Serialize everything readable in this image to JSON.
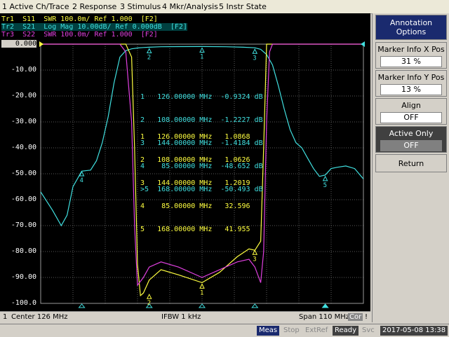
{
  "menu": [
    "1 Active Ch/Trace",
    "2 Response",
    "3 Stimulus",
    "4 Mkr/Analysis",
    "5 Instr State"
  ],
  "traces": [
    {
      "label": "Tr1  S11  SWR 100.0m/ Ref 1.000  [F2]",
      "color": "#ffff40"
    },
    {
      "label": "Tr2  S21  Log Mag 10.00dB/ Ref 0.000dB  [F2]",
      "color": "#40e0e0"
    },
    {
      "label": "Tr3  S22  SWR 100.0m/ Ref 1.000  [F2]",
      "color": "#e040e0"
    }
  ],
  "y_labels": [
    "0.000",
    "-10.00",
    "-20.00",
    "-30.00",
    "-40.00",
    "-50.00",
    "-60.00",
    "-70.00",
    "-80.00",
    "-90.00",
    "-100.0"
  ],
  "marker_table_s21": [
    "1   126.00000 MHz  -0.9324 dB",
    "2   108.00000 MHz  -1.2227 dB",
    "3   144.00000 MHz  -1.4184 dB",
    "4    85.00000 MHz  -48.652 dB",
    ">5  168.00000 MHz  -50.493 dB"
  ],
  "marker_table_swr": [
    "1   126.00000 MHz   1.0868",
    "2   108.00000 MHz   1.0626",
    "3   144.00000 MHz   1.2019",
    "4    85.00000 MHz   32.596",
    "5   168.00000 MHz   41.955"
  ],
  "sidepanel": {
    "title": "Annotation Options",
    "marker_x_label": "Marker Info X Pos",
    "marker_x_value": "31 %",
    "marker_y_label": "Marker Info Y Pos",
    "marker_y_value": "13 %",
    "align_label": "Align",
    "align_value": "OFF",
    "active_only_label": "Active Only",
    "active_only_value": "OFF",
    "return_label": "Return"
  },
  "status": {
    "channel": "1",
    "center": "Center 126 MHz",
    "ifbw": "IFBW 1 kHz",
    "span": "Span 110 MHz",
    "cor": "Cor",
    "excl": "!"
  },
  "bottom": {
    "meas": "Meas",
    "stop": "Stop",
    "extref": "ExtRef",
    "ready": "Ready",
    "svc": "Svc",
    "datetime": "2017-05-08 13:38"
  },
  "chart_data": {
    "type": "line",
    "x": [
      71,
      126,
      181
    ],
    "xlabel": "",
    "ylabel": "",
    "ylim": [
      -100,
      0
    ],
    "series": [
      {
        "name": "S21",
        "x_mhz": [
          71,
          75,
          78,
          80,
          82,
          85,
          88,
          90,
          92,
          94,
          96,
          98,
          100,
          102,
          104,
          106,
          108,
          112,
          118,
          126,
          134,
          140,
          144,
          146,
          148,
          150,
          152,
          154,
          156,
          158,
          160,
          162,
          164,
          166,
          168,
          170,
          172,
          175,
          178,
          181
        ],
        "values": [
          -57,
          -64,
          -70,
          -66,
          -55,
          -49,
          -48.6,
          -45,
          -38,
          -28,
          -15,
          -5,
          -2.5,
          -1.8,
          -1.5,
          -1.3,
          -1.2,
          -1.0,
          -0.95,
          -0.93,
          -1.0,
          -1.2,
          -1.4,
          -2,
          -4,
          -8,
          -16,
          -25,
          -33,
          -38,
          -40,
          -44,
          -48,
          -51,
          -50.5,
          -48,
          -47.5,
          -47,
          -48,
          -52
        ]
      },
      {
        "name": "S11",
        "x_mhz": [
          71,
          100,
          102,
          103,
          104,
          105,
          106,
          108,
          112,
          118,
          126,
          132,
          138,
          142,
          144,
          146,
          147,
          148,
          150,
          181
        ],
        "values": [
          0,
          0,
          -5,
          -40,
          -85,
          -97,
          -96,
          -91,
          -87,
          -89,
          -92,
          -88,
          -82,
          -79,
          -79.5,
          -76,
          -40,
          0,
          0,
          0
        ]
      },
      {
        "name": "S22",
        "x_mhz": [
          71,
          98,
          100,
          102,
          103,
          104,
          106,
          108,
          112,
          118,
          126,
          132,
          138,
          142,
          144,
          146,
          147,
          148,
          149,
          150,
          181
        ],
        "values": [
          0,
          0,
          -3,
          -30,
          -70,
          -93,
          -90,
          -86,
          -84,
          -86,
          -90,
          -87,
          -84,
          -83,
          -86,
          -92,
          -80,
          -30,
          -3,
          0,
          0
        ]
      }
    ]
  }
}
